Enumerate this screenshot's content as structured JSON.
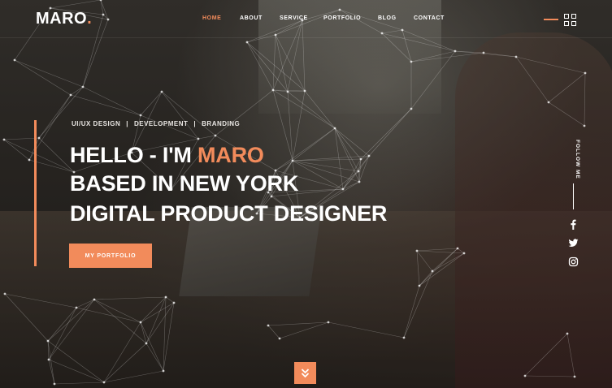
{
  "header": {
    "logo_text": "MARO",
    "logo_dot": ".",
    "nav": [
      "HOME",
      "ABOUT",
      "SERVICE",
      "PORTFOLIO",
      "BLOG",
      "CONTACT"
    ],
    "active_nav": "HOME"
  },
  "hero": {
    "tags": [
      "UI/UX DESIGN",
      "DEVELOPMENT",
      "BRANDING"
    ],
    "tag_separator": "|",
    "headline_line1_prefix": "HELLO - I'M ",
    "headline_line1_name": "MARO",
    "headline_line2": "BASED IN NEW YORK",
    "headline_line3": "DIGITAL PRODUCT DESIGNER",
    "cta_label": "MY PORTFOLIO"
  },
  "sidebar": {
    "follow_label": "FOLLOW ME",
    "social_icons": [
      "facebook-icon",
      "twitter-icon",
      "instagram-icon"
    ]
  },
  "icons": {
    "menu": "grid-menu-icon",
    "scroll": "chevron-double-down-icon"
  },
  "colors": {
    "accent": "#f28b5b",
    "text": "#ffffff",
    "background": "#2a2622"
  }
}
